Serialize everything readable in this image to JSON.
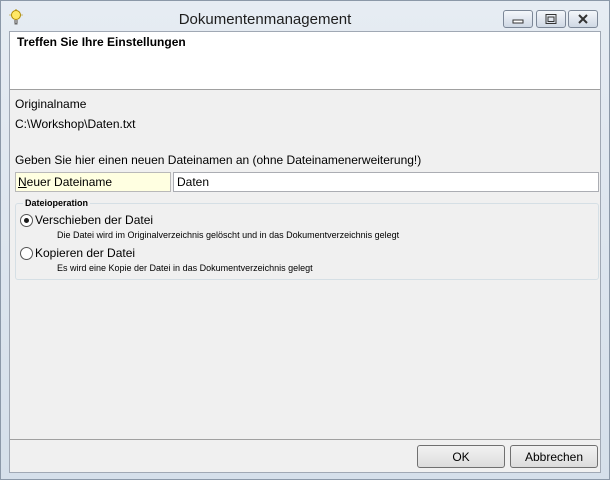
{
  "window": {
    "title": "Dokumentenmanagement",
    "icon": "lightbulb-icon"
  },
  "banner": {
    "title": "Treffen Sie Ihre Einstellungen"
  },
  "original": {
    "label": "Originalname",
    "value": "C:\\Workshop\\Daten.txt"
  },
  "rename": {
    "prompt": "Geben Sie hier einen neuen Dateinamen an (ohne Dateinamenerweiterung!)",
    "field_label_mnemonic": "N",
    "field_label_rest": "euer Dateiname",
    "field_value": "Daten"
  },
  "operation": {
    "legend": "Dateioperation",
    "options": [
      {
        "label": "Verschieben der Datei",
        "description": "Die Datei wird im Originalverzeichnis gelöscht und in das Dokumentverzeichnis gelegt",
        "selected": true
      },
      {
        "label": "Kopieren der Datei",
        "description": "Es wird eine Kopie der Datei in das Dokumentverzeichnis gelegt",
        "selected": false
      }
    ]
  },
  "buttons": {
    "ok": "OK",
    "cancel": "Abbrechen"
  }
}
